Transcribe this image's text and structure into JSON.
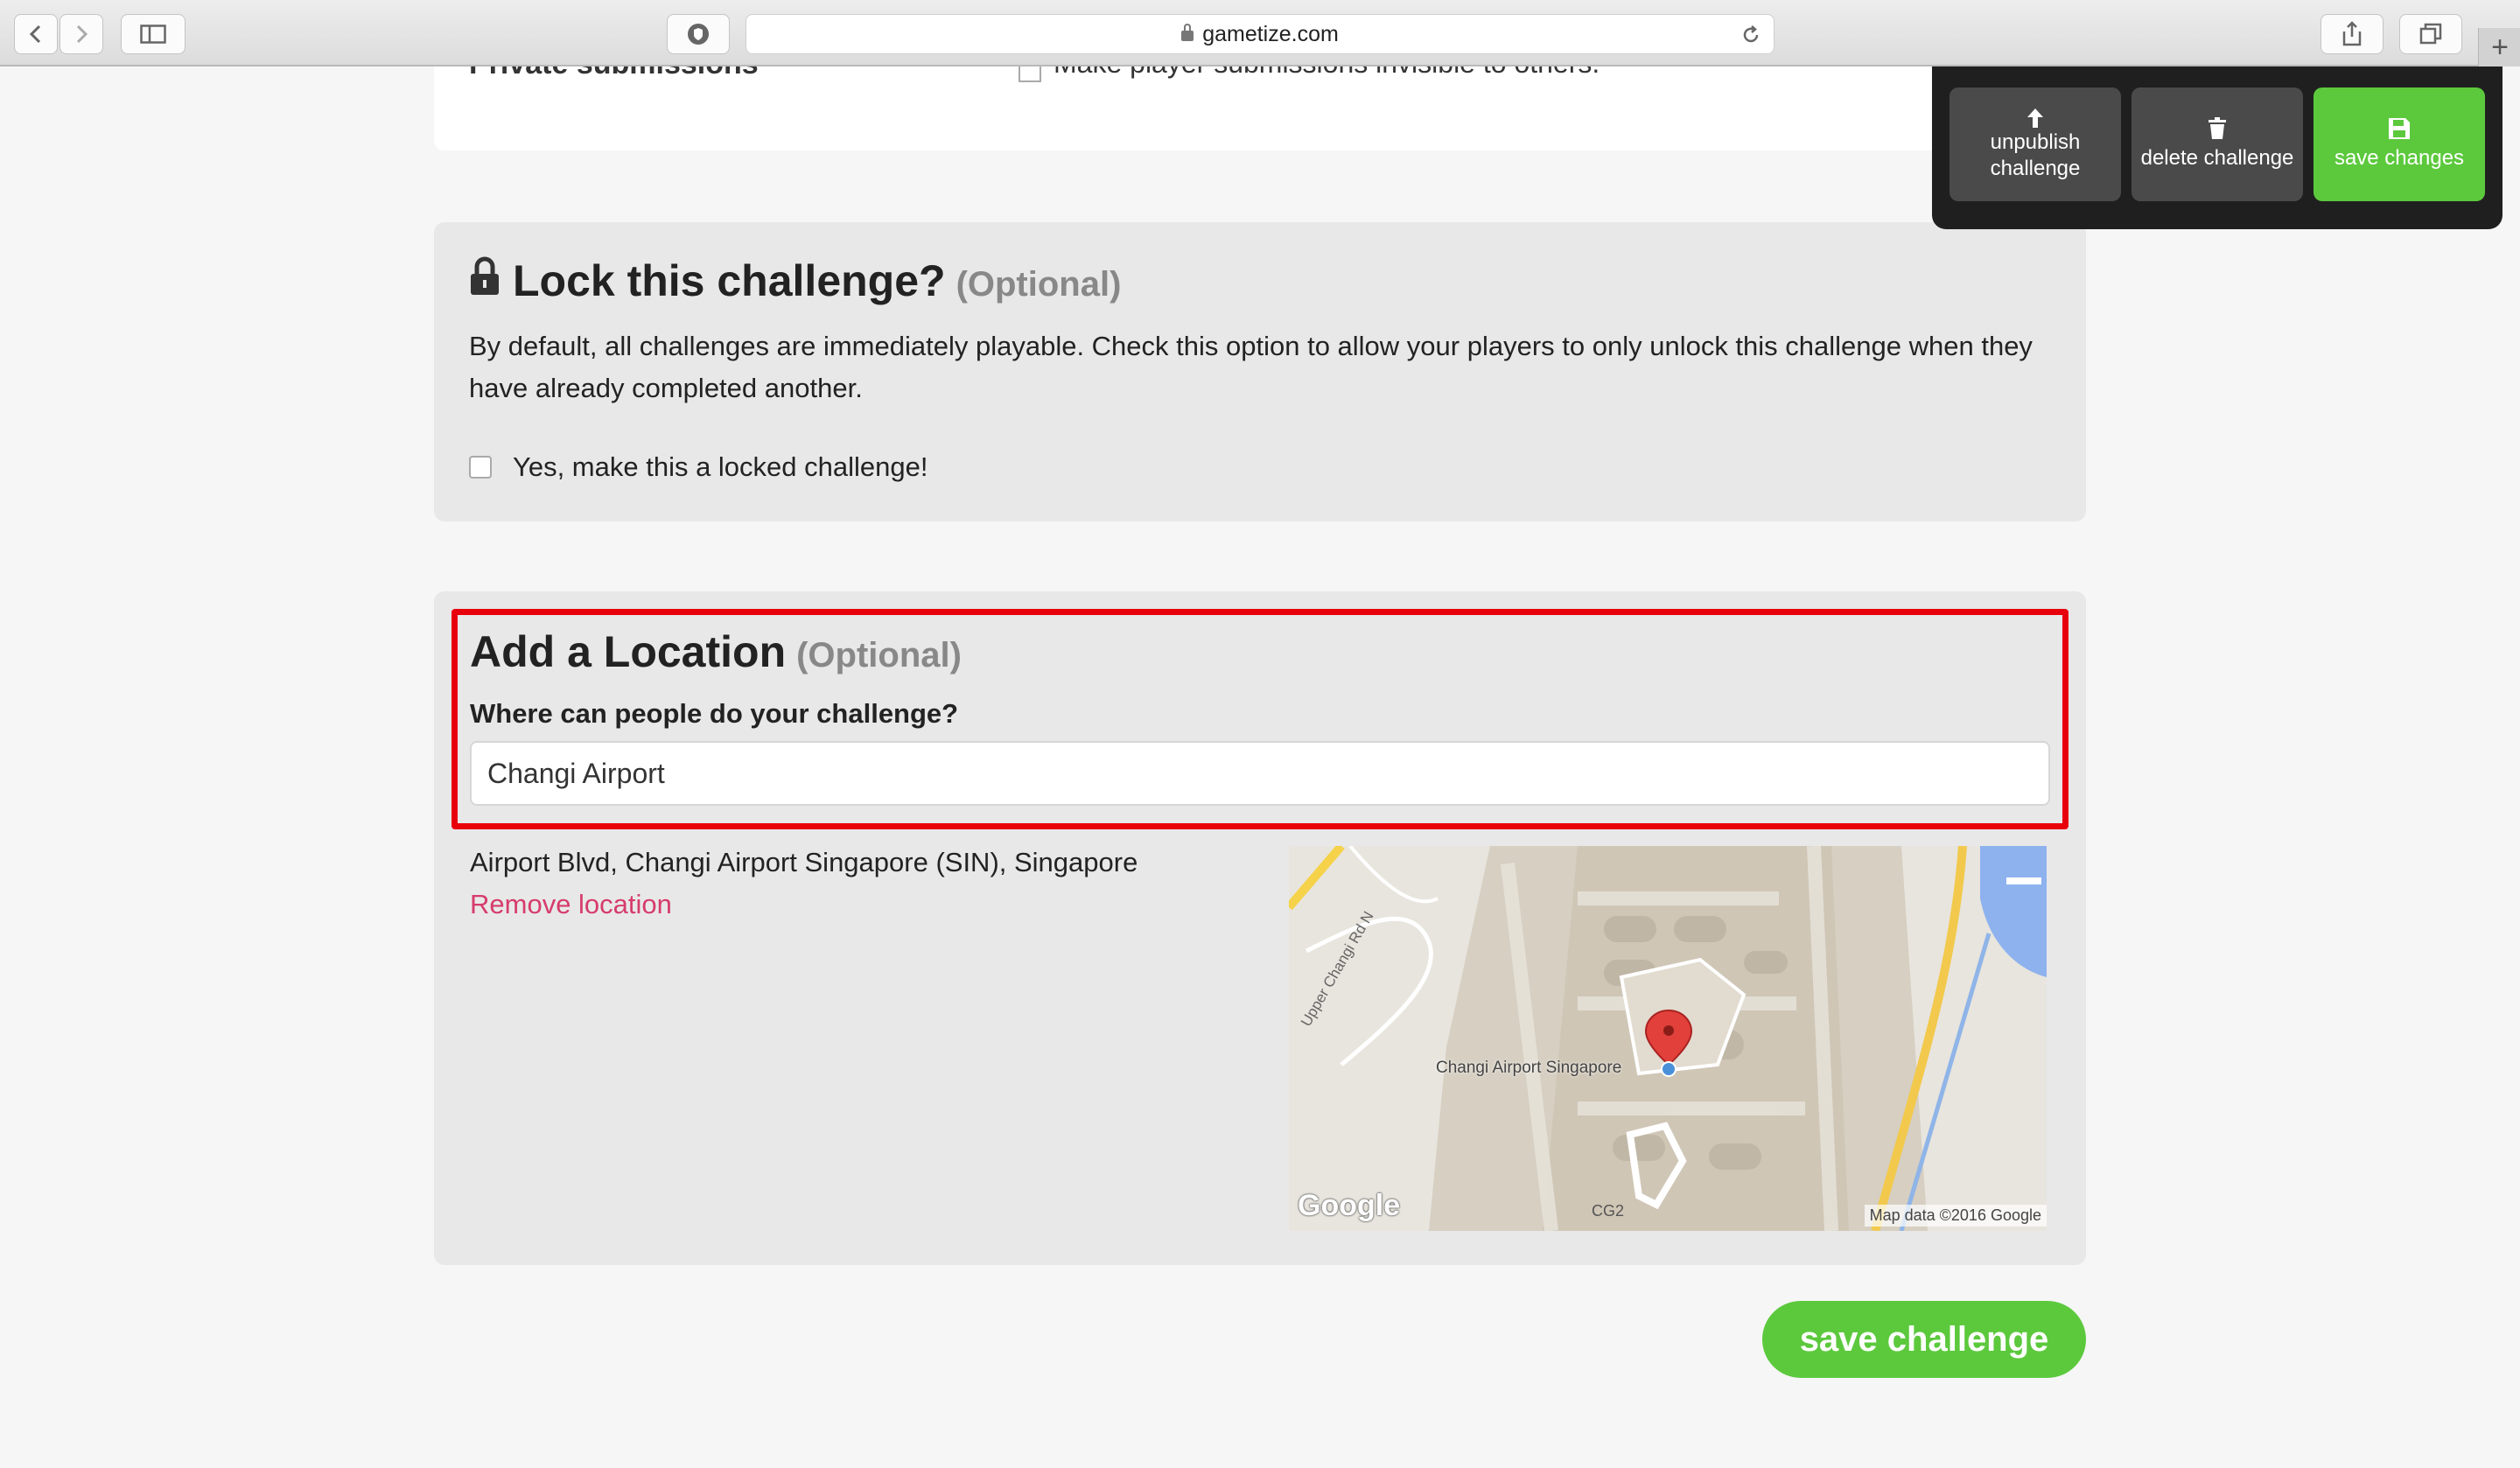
{
  "browser": {
    "url": "gametize.com"
  },
  "top_card": {
    "private_label": "Private submissions",
    "private_option": "Make player submissions invisible to others."
  },
  "lock_section": {
    "title": "Lock this challenge?",
    "optional": "(Optional)",
    "description": "By default, all challenges are immediately playable. Check this option to allow your players to only unlock this challenge when they have already completed another.",
    "checkbox_label": "Yes, make this a locked challenge!"
  },
  "location_section": {
    "title": "Add a Location",
    "optional": "(Optional)",
    "question": "Where can people do your challenge?",
    "input_value": "Changi Airport",
    "address": "Airport Blvd, Changi Airport Singapore (SIN), Singapore",
    "remove_link": "Remove location",
    "map": {
      "place_label": "Changi Airport Singapore",
      "road_label": "Upper Changi Rd N",
      "cg_label": "CG2",
      "google_logo": "Google",
      "attribution": "Map data ©2016 Google"
    }
  },
  "toolbar": {
    "unpublish_line1": "unpublish",
    "unpublish_line2": "challenge",
    "delete_label": "delete challenge",
    "save_label": "save changes"
  },
  "save_challenge_label": "save challenge",
  "colors": {
    "accent_green": "#5cc93d",
    "highlight_red": "#e8000b",
    "link_pink": "#d63c6c"
  }
}
